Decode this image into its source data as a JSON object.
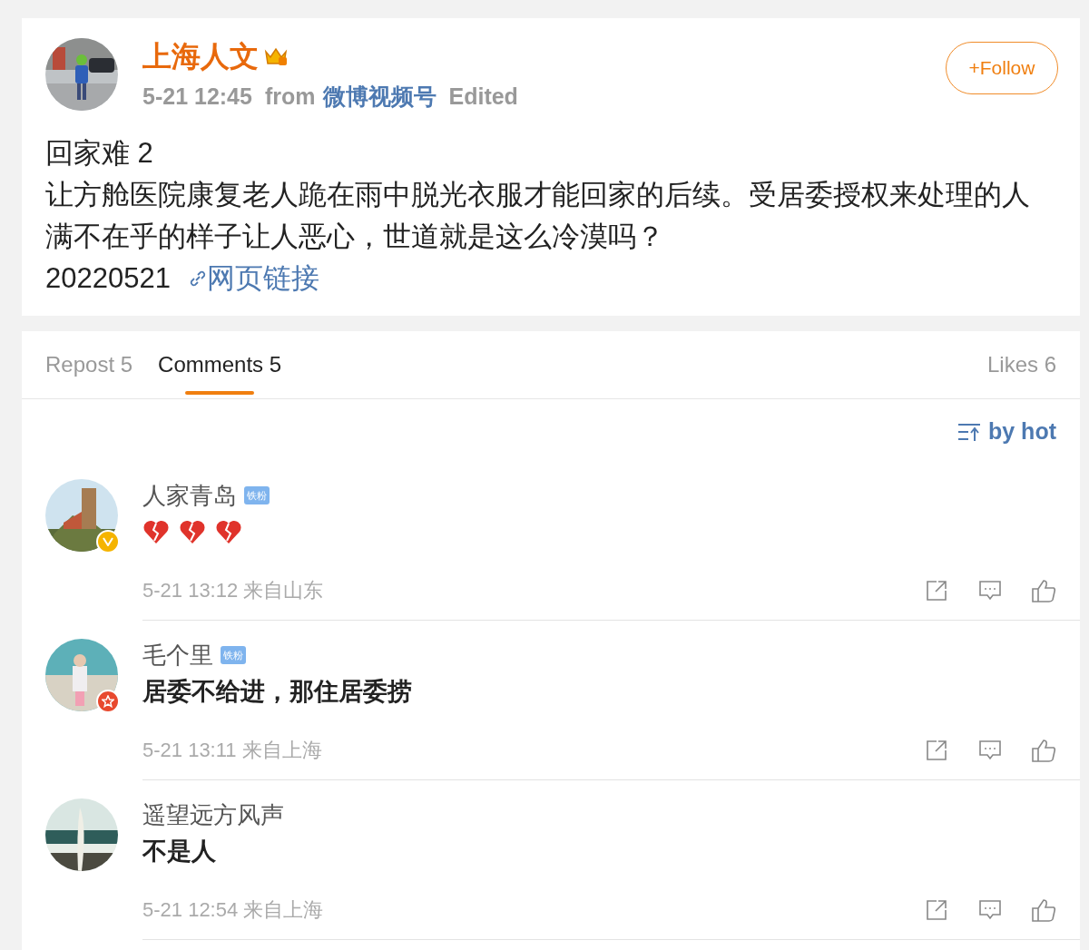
{
  "post": {
    "author": "上海人文",
    "time": "5-21 12:45",
    "from_label": "from",
    "source": "微博视频号",
    "edited": "Edited",
    "follow": "+Follow",
    "title": "回家难 2",
    "body": "让方舱医院康复老人跪在雨中脱光衣服才能回家的后续。受居委授权来处理的人满不在乎的样子让人恶心，世道就是这么冷漠吗？",
    "date": "20220521",
    "link": "网页链接"
  },
  "tabs": [
    {
      "label": "Repost 5",
      "selected": false
    },
    {
      "label": "Comments 5",
      "selected": true
    },
    {
      "label": "Likes 6",
      "selected": false
    }
  ],
  "sort": "by hot",
  "comments": [
    {
      "name": "人家青岛",
      "badge": "铁粉",
      "kind": "emoji",
      "emojis": [
        {
          "kind": "broken_heart"
        },
        {
          "kind": "broken_heart"
        },
        {
          "kind": "broken_heart"
        }
      ],
      "avatar_badge": {
        "kind": "v",
        "color": "#f5b400"
      },
      "time": "5-21 13:12 来自山东"
    },
    {
      "name": "毛个里",
      "badge": "铁粉",
      "kind": "text",
      "text": "居委不给进，那住居委捞",
      "avatar_badge": {
        "kind": "star",
        "color": "#e8492e"
      },
      "time": "5-21 13:11 来自上海"
    },
    {
      "name": "遥望远方风声",
      "kind": "text",
      "text": "不是人",
      "time": "5-21 12:54 来自上海"
    }
  ]
}
